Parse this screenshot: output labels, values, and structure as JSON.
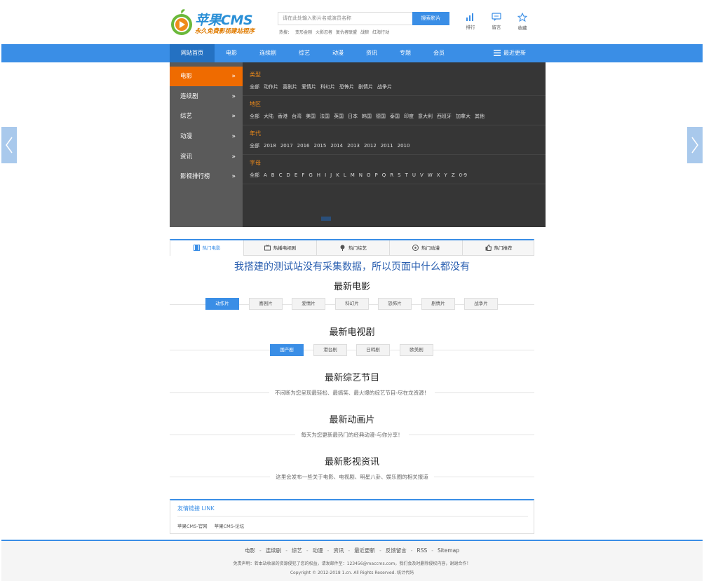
{
  "header": {
    "logo_title": "苹果CMS",
    "logo_subtitle": "永久免费影视建站程序",
    "search_placeholder": "请在此处输入影片名或演员名称",
    "search_button": "搜索影片",
    "hot_label": "热搜：",
    "hot_words": [
      "变形金刚",
      "火影忍者",
      "复仇者联盟",
      "战狼",
      "红海行动"
    ],
    "tools": [
      {
        "label": "排行",
        "icon": "bar-chart-icon"
      },
      {
        "label": "留言",
        "icon": "message-icon"
      },
      {
        "label": "收藏",
        "icon": "star-icon"
      }
    ]
  },
  "nav": {
    "items": [
      "网站首页",
      "电影",
      "连续剧",
      "综艺",
      "动漫",
      "资讯",
      "专题",
      "会员"
    ],
    "active_index": 0,
    "recent_label": "最近更新"
  },
  "banner": {
    "side_items": [
      "电影",
      "连续剧",
      "综艺",
      "动漫",
      "资讯",
      "影视排行榜"
    ],
    "active_side_index": 0,
    "chevron": "»",
    "filters": [
      {
        "title": "类型",
        "options": [
          "全部",
          "动作片",
          "喜剧片",
          "爱情片",
          "科幻片",
          "恐怖片",
          "剧情片",
          "战争片"
        ]
      },
      {
        "title": "地区",
        "options": [
          "全部",
          "大陆",
          "香港",
          "台湾",
          "美国",
          "法国",
          "英国",
          "日本",
          "韩国",
          "德国",
          "泰国",
          "印度",
          "意大利",
          "西班牙",
          "加拿大",
          "其他"
        ]
      },
      {
        "title": "年代",
        "options": [
          "全部",
          "2018",
          "2017",
          "2016",
          "2015",
          "2014",
          "2013",
          "2012",
          "2011",
          "2010"
        ]
      },
      {
        "title": "字母",
        "options": [
          "全部",
          "A",
          "B",
          "C",
          "D",
          "E",
          "F",
          "G",
          "H",
          "I",
          "J",
          "K",
          "L",
          "M",
          "N",
          "O",
          "P",
          "Q",
          "R",
          "S",
          "T",
          "U",
          "V",
          "W",
          "X",
          "Y",
          "Z",
          "0-9"
        ]
      }
    ]
  },
  "tabs": [
    {
      "label": "热门电影",
      "icon": "film-icon"
    },
    {
      "label": "热播电视剧",
      "icon": "tv-icon"
    },
    {
      "label": "热门综艺",
      "icon": "mic-icon"
    },
    {
      "label": "热门动漫",
      "icon": "smile-icon"
    },
    {
      "label": "热门推荐",
      "icon": "thumb-icon"
    }
  ],
  "notice": "我搭建的测试站没有采集数据，所以页面中什么都没有",
  "sections": {
    "movies": {
      "title": "最新电影",
      "pills": [
        "动作片",
        "喜剧片",
        "爱情片",
        "科幻片",
        "恐怖片",
        "剧情片",
        "战争片"
      ],
      "active": 0
    },
    "tv": {
      "title": "最新电视剧",
      "pills": [
        "国产剧",
        "港台剧",
        "日韩剧",
        "欧美剧"
      ],
      "active": 0
    },
    "variety": {
      "title": "最新综艺节目",
      "desc": "不间断为您呈现最轻松、最搞笑、最火爆的综艺节目-尽在龙资源！"
    },
    "anime": {
      "title": "最新动画片",
      "desc": "每天为您更新最热门的经典动漫-与你分享！"
    },
    "news": {
      "title": "最新影视资讯",
      "desc": "这里会发布一些关于电影、电视剧、明星八卦、娱乐圈的相关报道"
    }
  },
  "links": {
    "title": "友情链接 LINK",
    "items": [
      "苹果CMS-官网",
      "苹果CMS-论坛"
    ]
  },
  "footer": {
    "nav": [
      "电影",
      "连续剧",
      "综艺",
      "动漫",
      "资讯",
      "最近更新",
      "反馈留言",
      "RSS",
      "Sitemap"
    ],
    "disclaimer": "免责声明：若本站收录的资源侵犯了您的权益，请发邮件至：123456@maccms.com，我们会及时删除侵权内容，谢谢合作！",
    "copyright": "Copyright © 2012-2018 1.cn. All Rights Reserved. 统计代码"
  },
  "colors": {
    "accent": "#3a8ee6",
    "orange": "#ef6b00",
    "banner_bg": "#363636"
  }
}
